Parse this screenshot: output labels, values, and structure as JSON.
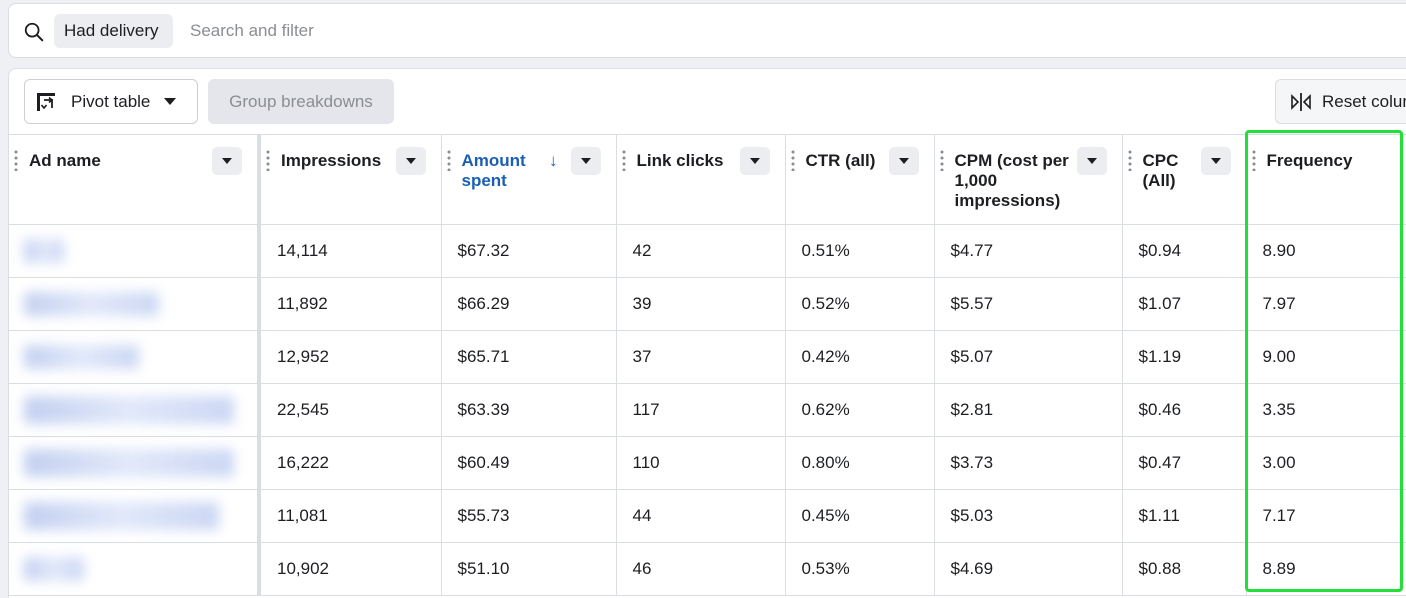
{
  "search": {
    "chip_label": "Had delivery",
    "placeholder": "Search and filter"
  },
  "toolbar": {
    "pivot_label": "Pivot table",
    "group_label": "Group breakdowns",
    "reset_label": "Reset colum"
  },
  "table": {
    "columns": [
      {
        "label": "Ad name"
      },
      {
        "label": "Impressions"
      },
      {
        "label": "Amount spent"
      },
      {
        "label": "Link clicks"
      },
      {
        "label": "CTR (all)"
      },
      {
        "label": "CPM (cost per 1,000 impressions)"
      },
      {
        "label": "CPC (All)"
      },
      {
        "label": "Frequency"
      }
    ],
    "rows": [
      {
        "impressions": "14,114",
        "amount": "$67.32",
        "clicks": "42",
        "ctr": "0.51%",
        "cpm": "$4.77",
        "cpc": "$0.94",
        "freq": "8.90"
      },
      {
        "impressions": "11,892",
        "amount": "$66.29",
        "clicks": "39",
        "ctr": "0.52%",
        "cpm": "$5.57",
        "cpc": "$1.07",
        "freq": "7.97"
      },
      {
        "impressions": "12,952",
        "amount": "$65.71",
        "clicks": "37",
        "ctr": "0.42%",
        "cpm": "$5.07",
        "cpc": "$1.19",
        "freq": "9.00"
      },
      {
        "impressions": "22,545",
        "amount": "$63.39",
        "clicks": "117",
        "ctr": "0.62%",
        "cpm": "$2.81",
        "cpc": "$0.46",
        "freq": "3.35"
      },
      {
        "impressions": "16,222",
        "amount": "$60.49",
        "clicks": "110",
        "ctr": "0.80%",
        "cpm": "$3.73",
        "cpc": "$0.47",
        "freq": "3.00"
      },
      {
        "impressions": "11,081",
        "amount": "$55.73",
        "clicks": "44",
        "ctr": "0.45%",
        "cpm": "$5.03",
        "cpc": "$1.11",
        "freq": "7.17"
      },
      {
        "impressions": "10,902",
        "amount": "$51.10",
        "clicks": "46",
        "ctr": "0.53%",
        "cpm": "$4.69",
        "cpc": "$0.88",
        "freq": "8.89"
      }
    ]
  },
  "colors": {
    "sorted_header": "#1a5fb4",
    "highlight": "#22e03a"
  }
}
